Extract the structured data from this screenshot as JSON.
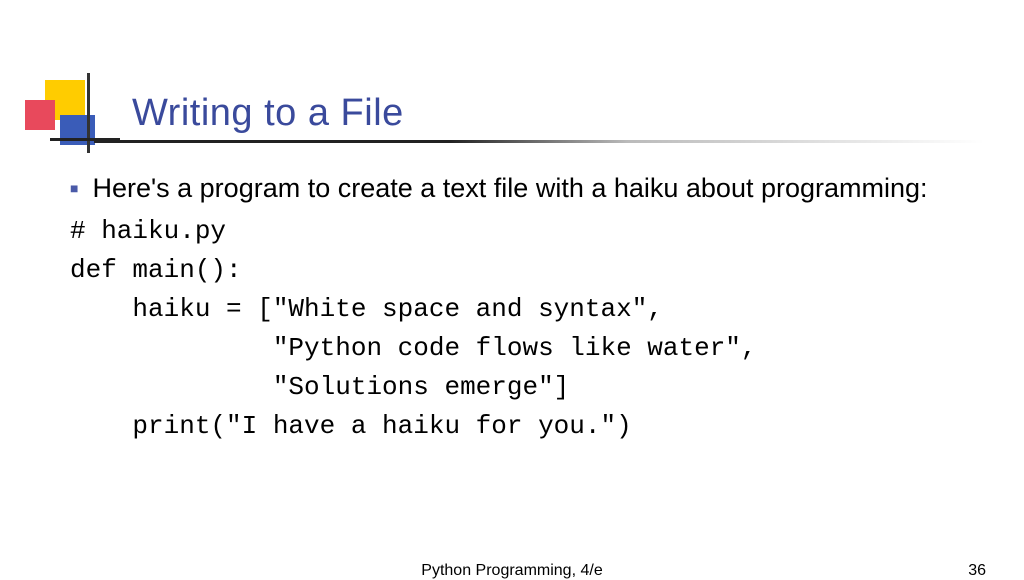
{
  "title": "Writing to a File",
  "bullet_text": "Here's a program to create a text file with a haiku about programming:",
  "code": {
    "l1": "# haiku.py",
    "l2": "def main():",
    "l3": "    haiku = [\"White space and syntax\",",
    "l4": "             \"Python code flows like water\",",
    "l5": "             \"Solutions emerge\"]",
    "l6": "    print(\"I have a haiku for you.\")"
  },
  "footer": {
    "center": "Python Programming, 4/e",
    "page": "36"
  }
}
